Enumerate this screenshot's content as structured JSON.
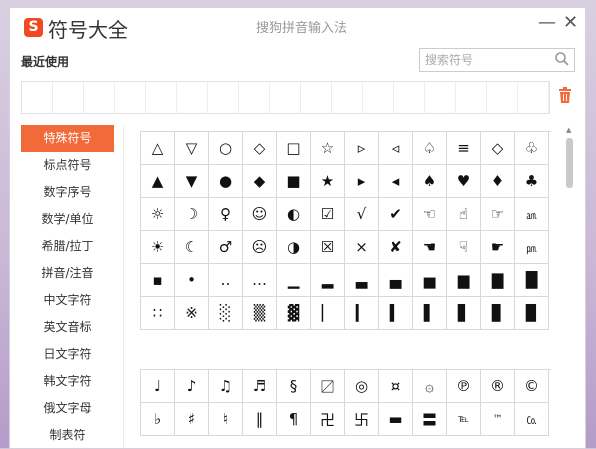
{
  "app": {
    "logo_letter": "S",
    "title": "符号大全",
    "subtitle": "搜狗拼音输入法",
    "minimize": "—",
    "close": "✕"
  },
  "recent": {
    "label": "最近使用",
    "slots": 17
  },
  "search": {
    "placeholder": "搜索符号",
    "value": ""
  },
  "colors": {
    "accent": "#f26a3a",
    "logo": "#f04a23"
  },
  "sidebar": {
    "items": [
      {
        "label": "特殊符号",
        "active": true
      },
      {
        "label": "标点符号"
      },
      {
        "label": "数字序号"
      },
      {
        "label": "数学/单位"
      },
      {
        "label": "希腊/拉丁"
      },
      {
        "label": "拼音/注音"
      },
      {
        "label": "中文字符"
      },
      {
        "label": "英文音标"
      },
      {
        "label": "日文字符"
      },
      {
        "label": "韩文字符"
      },
      {
        "label": "俄文字母"
      },
      {
        "label": "制表符"
      }
    ]
  },
  "panel1": {
    "symbols": [
      "△",
      "▽",
      "○",
      "◇",
      "□",
      "☆",
      "▹",
      "◃",
      "♤",
      "≡",
      "◇",
      "♧",
      "▲",
      "▼",
      "●",
      "◆",
      "■",
      "★",
      "▸",
      "◂",
      "♠",
      "♥",
      "♦",
      "♣",
      "☼",
      "☽",
      "♀",
      "☺",
      "◐",
      "☑",
      "√",
      "✔",
      "☜",
      "☝",
      "☞",
      "㏂",
      "☀",
      "☾",
      "♂",
      "☹",
      "◑",
      "☒",
      "×",
      "✘",
      "☚",
      "☟",
      "☛",
      "㏘",
      "▪",
      "•",
      "‥",
      "…",
      "▁",
      "▂",
      "▃",
      "▄",
      "▅",
      "▆",
      "▇",
      "█",
      "∷",
      "※",
      "░",
      "▒",
      "▓",
      "▏",
      "▎",
      "▍",
      "▌",
      "▋",
      "▊",
      "▉"
    ]
  },
  "panel2": {
    "symbols": [
      "♩",
      "♪",
      "♫",
      "♬",
      "§",
      "〼",
      "◎",
      "¤",
      "۞",
      "℗",
      "®",
      "©",
      "♭",
      "♯",
      "♮",
      "‖",
      "¶",
      "卍",
      "卐",
      "▬",
      "〓",
      "℡",
      "™",
      "㏇"
    ]
  }
}
